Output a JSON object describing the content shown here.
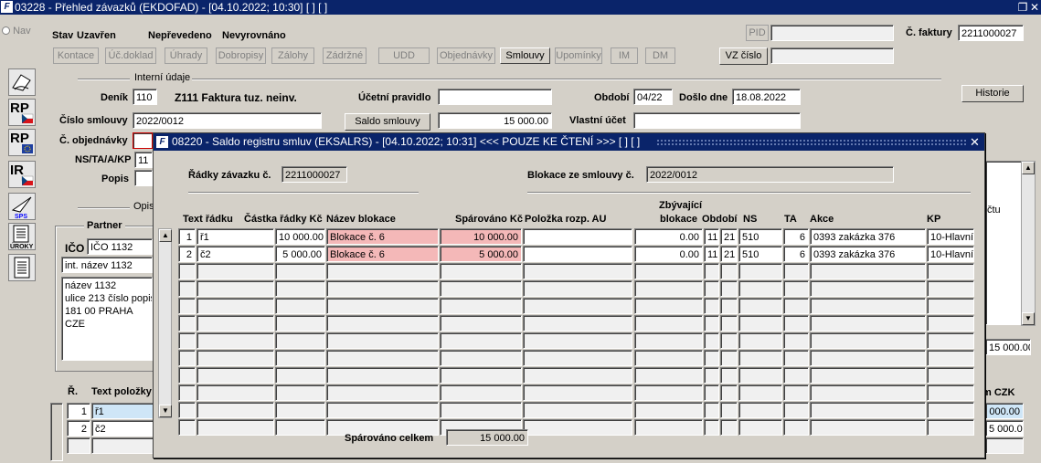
{
  "window": {
    "title": "03228 - Přehled závazků (EKDOFAD) - [04.10.2022; 10:30] [ ] [ ]"
  },
  "nav_label": "Nav",
  "status": {
    "stav_label": "Stav",
    "stav_value": "Uzavřen",
    "prevedeni": "Nepřevedeno",
    "vyrovnani": "Nevyrovnáno"
  },
  "tabs": [
    "Kontace",
    "Úč.doklad",
    "Úhrady",
    "Dobropisy",
    "Zálohy",
    "Zádržné",
    "UDD",
    "Objednávky",
    "Smlouvy",
    "Upomínky",
    "IM",
    "DM"
  ],
  "active_tab": "Smlouvy",
  "pid_label": "PID",
  "faktura": {
    "label": "Č. faktury",
    "value": "2211000027"
  },
  "vz_button": "VZ číslo",
  "section_interni": "Interní údaje",
  "historie_button": "Historie",
  "form": {
    "denik_label": "Deník",
    "denik_code": "110",
    "denik_name": "Z111 Faktura tuz. neinv.",
    "ucetni_pravidlo_label": "Účetní pravidlo",
    "obdobi_label": "Období",
    "obdobi_value": "04/22",
    "doslo_label": "Došlo dne",
    "doslo_value": "18.08.2022",
    "cislo_smlouvy_label": "Číslo smlouvy",
    "cislo_smlouvy_value": "2022/0012",
    "saldo_button": "Saldo smlouvy",
    "saldo_value": "15 000.00",
    "vlastni_ucet_label": "Vlastní účet",
    "objednavky_label": "Č. objednávky",
    "ns_label": "NS/TA/A/KP",
    "ns_value": "11",
    "popis_label": "Popis"
  },
  "opis_label": "Opis",
  "partner": {
    "title": "Partner",
    "ico_label": "IČO",
    "ico_value": "IČO 1132",
    "int_name": "int. název 1132",
    "address": [
      "název 1132",
      "ulice 213 číslo popis",
      "181 00 PRAHA",
      "CZE"
    ]
  },
  "right_partial": {
    "uctu": "čtu",
    "amount": "15 000.00",
    "m_czk": "m  CZK",
    "row_amounts": [
      "000.00",
      "5 000.00"
    ]
  },
  "items": {
    "r_header": "Ř.",
    "text_header": "Text položky",
    "rows": [
      {
        "n": "1",
        "text": "ř1"
      },
      {
        "n": "2",
        "text": "č2"
      }
    ]
  },
  "dialog": {
    "title": "08220 - Saldo registru smluv (EKSALRS) - [04.10.2022; 10:31] <<< POUZE KE ČTENÍ >>>  [ ]  [ ]",
    "radky_label": "Řádky závazku č.",
    "radky_value": "2211000027",
    "blokace_label": "Blokace ze smlouvy č.",
    "blokace_value": "2022/0012",
    "columns": {
      "text": "Text řádku",
      "castka": "Částka řádky Kč",
      "nazev": "Název blokace",
      "sparovano": "Spárováno Kč",
      "polozka": "Položka rozp. AU",
      "zbyvajici1": "Zbývající",
      "zbyvajici2": "blokace",
      "obdobi": "Období",
      "ns": "NS",
      "ta": "TA",
      "akce": "Akce",
      "kp": "KP"
    },
    "rows": [
      {
        "n": "1",
        "text": "ř1",
        "castka": "10 000.00",
        "nazev": "Blokace č. 6",
        "sparovano": "10 000.00",
        "polozka": "",
        "zbyva": "0.00",
        "obd1": "11",
        "obd2": "21",
        "ns": "510",
        "ta": "6",
        "akce": "0393 zakázka 376",
        "kp": "10-Hlavní"
      },
      {
        "n": "2",
        "text": "č2",
        "castka": "5 000.00",
        "nazev": "Blokace č. 6",
        "sparovano": "5 000.00",
        "polozka": "",
        "zbyva": "0.00",
        "obd1": "11",
        "obd2": "21",
        "ns": "510",
        "ta": "6",
        "akce": "0393 zakázka 376",
        "kp": "10-Hlavní"
      }
    ],
    "total_label": "Spárováno celkem",
    "total_value": "15 000.00"
  },
  "icons": [
    "sign-icon",
    "rp-cz-icon",
    "rp-eu-icon",
    "ir-cz-icon",
    "sps-icon",
    "uroky-icon",
    "document-icon"
  ]
}
